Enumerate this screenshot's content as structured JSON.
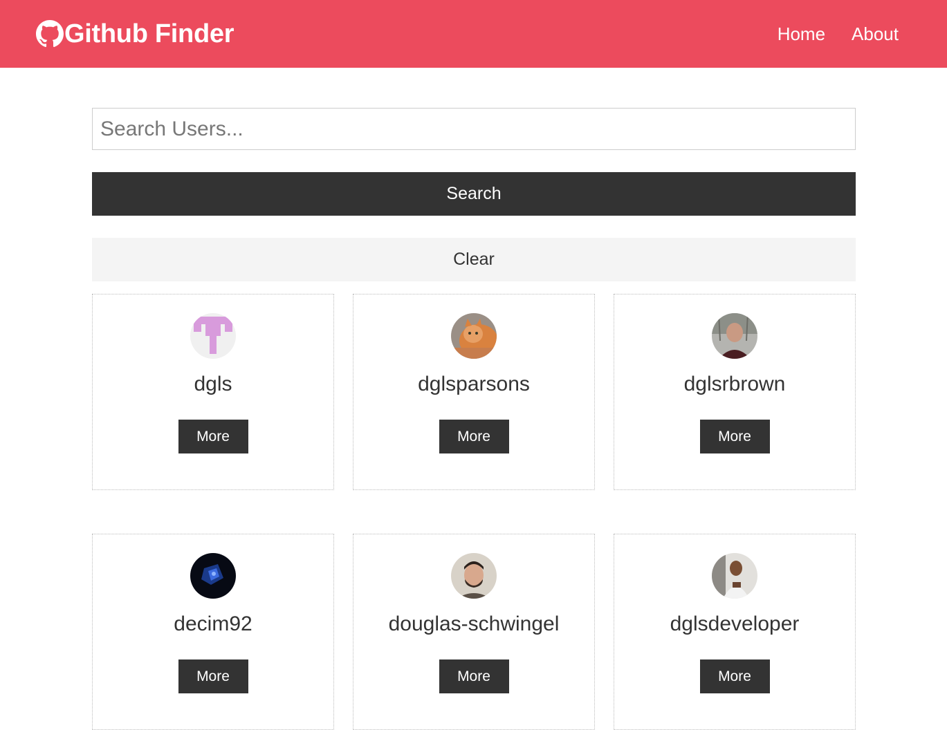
{
  "navbar": {
    "brand": "Github Finder",
    "brand_icon": "github-icon",
    "links": [
      {
        "label": "Home"
      },
      {
        "label": "About"
      }
    ],
    "background_color": "#ec4b5d"
  },
  "search": {
    "placeholder": "Search Users...",
    "value": "",
    "search_label": "Search",
    "clear_label": "Clear"
  },
  "users": [
    {
      "login": "dgls",
      "more_label": "More",
      "avatar": "identicon-avatar"
    },
    {
      "login": "dglsparsons",
      "more_label": "More",
      "avatar": "cat-photo-avatar"
    },
    {
      "login": "dglsrbrown",
      "more_label": "More",
      "avatar": "person-photo-avatar"
    },
    {
      "login": "decim92",
      "more_label": "More",
      "avatar": "dark-abstract-avatar"
    },
    {
      "login": "douglas-schwingel",
      "more_label": "More",
      "avatar": "person-photo-avatar"
    },
    {
      "login": "dglsdeveloper",
      "more_label": "More",
      "avatar": "person-photo-avatar"
    }
  ]
}
